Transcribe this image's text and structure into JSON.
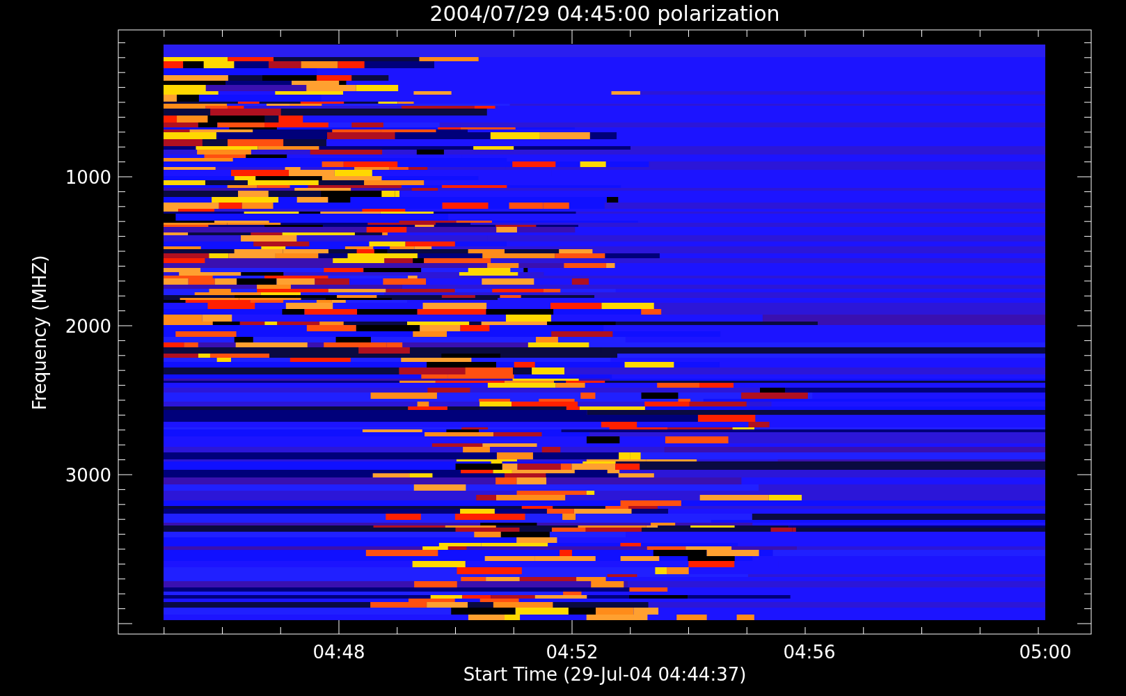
{
  "plot": {
    "title": "2004/07/29 04:45:00 polarization",
    "xlabel": "Start Time (29-Jul-04 04:44:37)",
    "ylabel": "Frequency (MHZ)",
    "xticks": [
      "04:48",
      "04:52",
      "04:56",
      "05:00"
    ],
    "yticks": [
      "1000",
      "2000",
      "3000"
    ]
  }
}
